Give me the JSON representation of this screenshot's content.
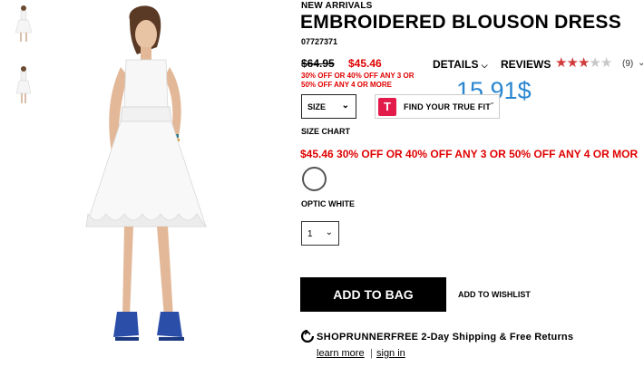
{
  "product": {
    "category_label": "NEW ARRIVALS",
    "title": "EMBROIDERED BLOUSON DRESS",
    "sku": "07727371",
    "old_price": "$64.95",
    "new_price": "$45.46",
    "promo_small": "30% OFF OR 40% OFF ANY 3 OR 50% OFF ANY 4 OR MORE",
    "promo_big": "$45.46 30% OFF OR 40% OFF ANY 3 OR 50% OFF ANY 4 OR MOR",
    "overlay_price": "15.91$",
    "color_name": "OPTIC WHITE"
  },
  "tabs": {
    "details_label": "DETAILS",
    "reviews_label": "REVIEWS",
    "review_count": "(9)",
    "rating": 3,
    "rating_max": 5
  },
  "controls": {
    "size_label": "SIZE",
    "truefit_logo": "T",
    "truefit_label": "FIND YOUR TRUE FIT",
    "size_chart_label": "SIZE CHART",
    "qty_value": "1",
    "add_to_bag_label": "ADD TO BAG",
    "wishlist_label": "ADD TO WISHLIST"
  },
  "shoprunner": {
    "brand": "SHOPRUNNER",
    "text": "FREE 2-Day Shipping & Free Returns",
    "learn_more": "learn more",
    "separator": "|",
    "sign_in": "sign in"
  },
  "colors": {
    "sale_red": "#e00000",
    "overlay_blue": "#2a86d0",
    "star_red": "#d03a3a",
    "truefit_pink": "#e31b4b"
  },
  "icons": {
    "details_chevron": "chevron-down-icon",
    "reviews_chevron": "chevron-down-icon",
    "shoprunner": "shoprunner-logo-icon"
  }
}
